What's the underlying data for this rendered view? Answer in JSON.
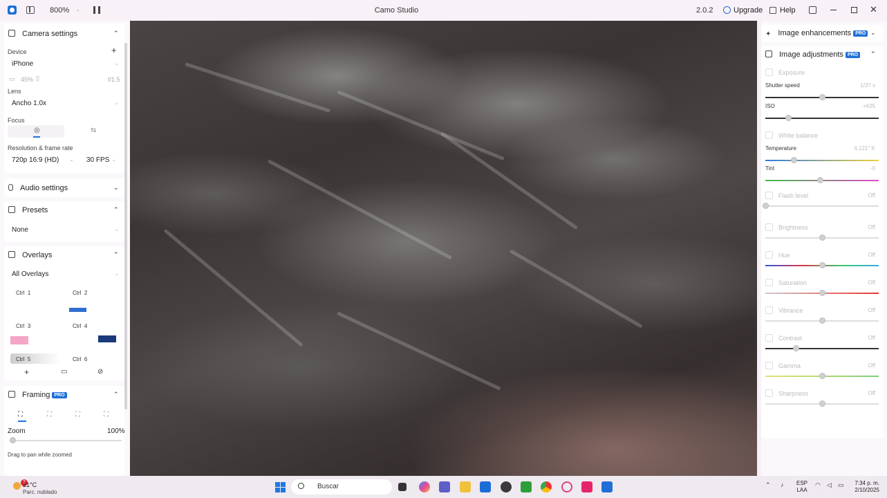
{
  "titlebar": {
    "zoom": "800%",
    "title": "Camo Studio",
    "version": "2.0.2",
    "upgrade": "Upgrade",
    "help": "Help"
  },
  "left": {
    "camera": {
      "title": "Camera settings",
      "device_label": "Device",
      "device": "iPhone",
      "battery": "45%",
      "aperture": "f/1.5",
      "lens_label": "Lens",
      "lens": "Ancho 1.0x",
      "focus_label": "Focus",
      "res_label": "Resolution & frame rate",
      "resolution": "720p 16:9 (HD)",
      "fps": "30 FPS"
    },
    "audio": {
      "title": "Audio settings"
    },
    "presets": {
      "title": "Presets",
      "value": "None"
    },
    "overlays": {
      "title": "Overlays",
      "filter": "All Overlays",
      "tiles": [
        {
          "key": "Ctrl",
          "num": "1"
        },
        {
          "key": "Ctrl",
          "num": "2"
        },
        {
          "key": "Ctrl",
          "num": "3"
        },
        {
          "key": "Ctrl",
          "num": "4"
        },
        {
          "key": "Ctrl",
          "num": "5"
        },
        {
          "key": "Ctrl",
          "num": "6"
        }
      ]
    },
    "framing": {
      "title": "Framing",
      "badge": "PRO",
      "zoom_label": "Zoom",
      "zoom_value": "100%",
      "hint": "Drag to pan while zoomed"
    }
  },
  "right": {
    "enhancements": {
      "title": "Image enhancements",
      "badge": "PRO"
    },
    "adjustments": {
      "title": "Image adjustments",
      "badge": "PRO",
      "exposure": "Exposure",
      "shutter_label": "Shutter speed",
      "shutter_val": "1/37 s",
      "iso_label": "ISO",
      "iso_val": "+635",
      "white_balance": "White balance",
      "temp_label": "Temperature",
      "temp_val": "4,121° K",
      "tint_label": "Tint",
      "tint_val": "-0",
      "flash": "Flash level",
      "brightness": "Brightness",
      "hue": "Hue",
      "saturation": "Saturation",
      "vibrance": "Vibrance",
      "contrast": "Contrast",
      "gamma": "Gamma",
      "sharpness": "Sharpness",
      "off": "Off",
      "levels": {
        "shutter": 0.5,
        "iso": 0.2,
        "temperature": 0.25,
        "tint": 0.48,
        "flash": 0.0,
        "brightness": 0.5,
        "hue": 0.5,
        "saturation": 0.5,
        "vibrance": 0.5,
        "contrast": 0.27,
        "gamma": 0.5,
        "sharpness": 0.5
      }
    }
  },
  "taskbar": {
    "temp": "21°C",
    "condition": "Parc. nublado",
    "badge": "2",
    "search": "Buscar",
    "lang1": "ESP",
    "lang2": "LAA",
    "time": "7:34 p. m.",
    "date": "2/10/2025"
  },
  "colors": {
    "accent": "#1f6fd6"
  }
}
